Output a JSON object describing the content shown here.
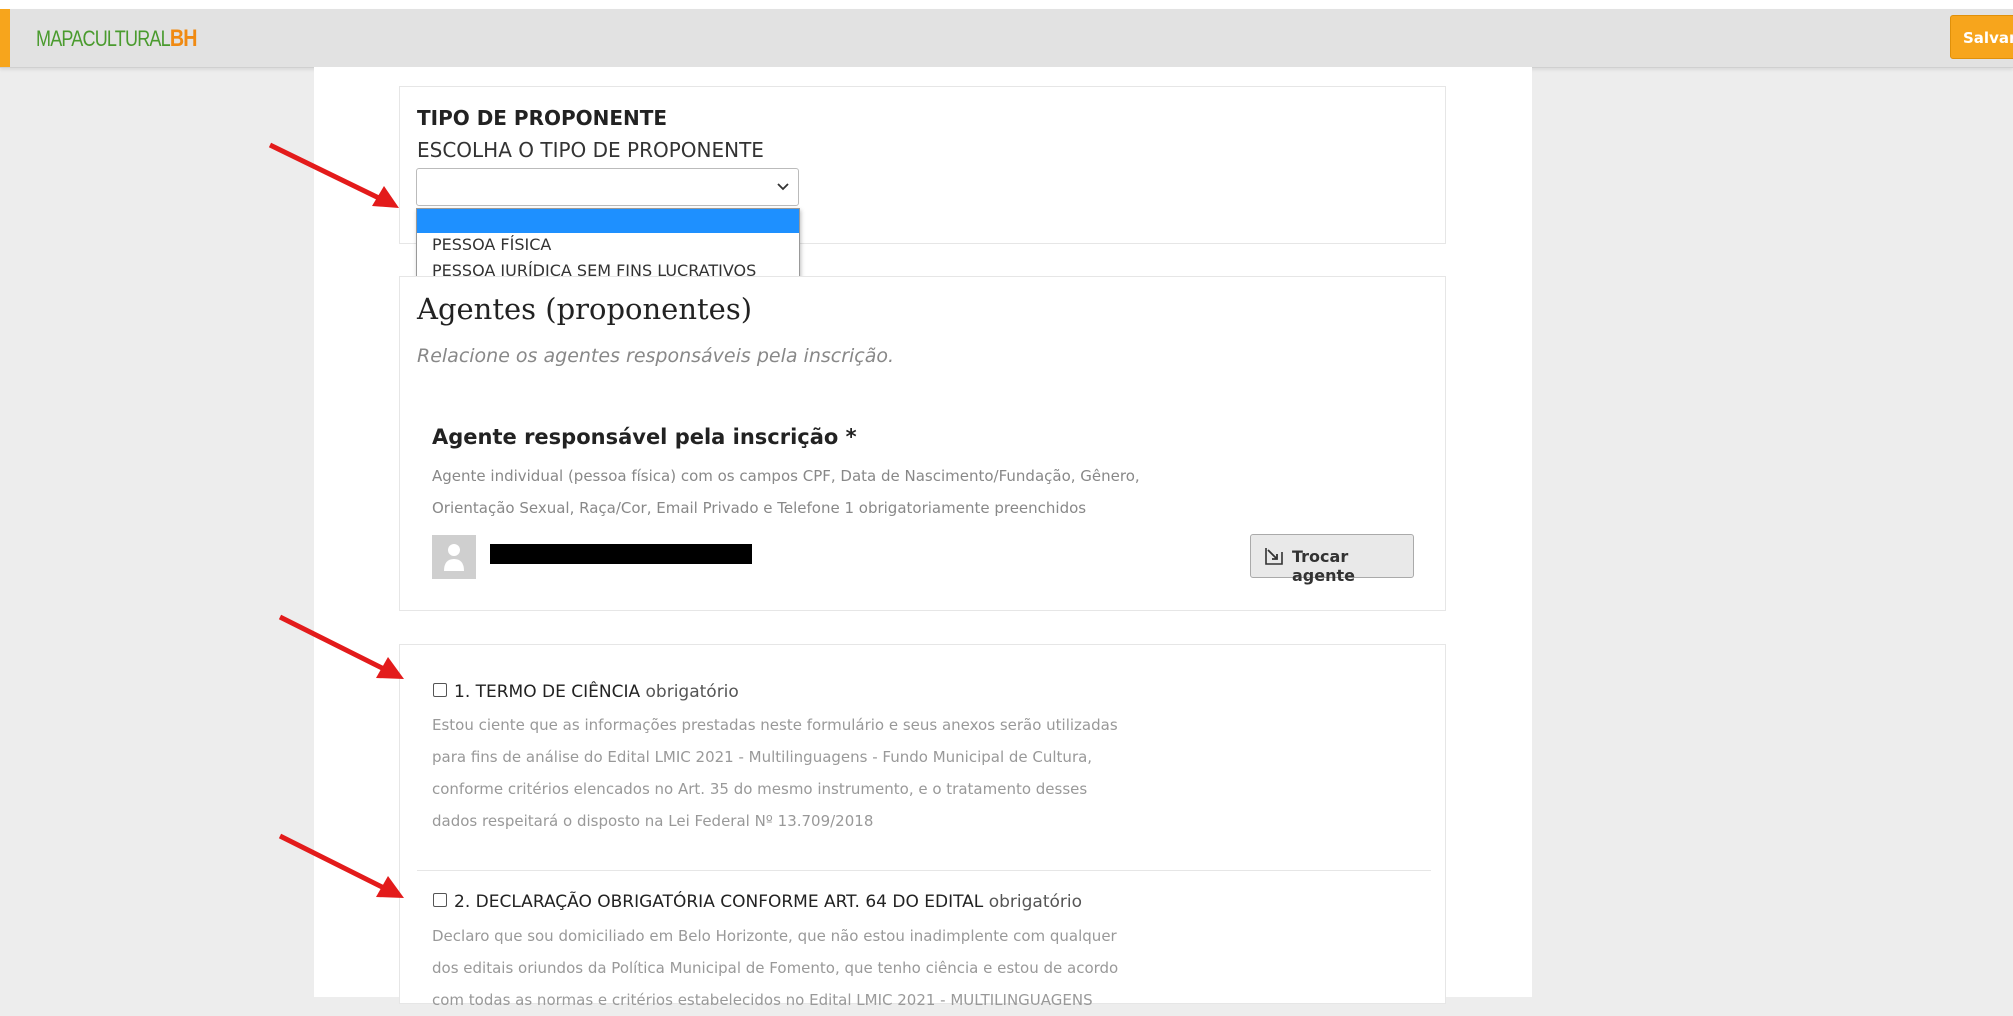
{
  "header": {
    "logo_part1": "MAPACULTURAL",
    "logo_part2": "BH",
    "save_label": "Salvar"
  },
  "proponente": {
    "title": "TIPO DE PROPONENTE",
    "subtitle": "ESCOLHA O TIPO DE PROPONENTE",
    "selected_value": "",
    "options": [
      "",
      "PESSOA FÍSICA",
      "PESSOA JURÍDICA SEM FINS LUCRATIVOS"
    ]
  },
  "agentes": {
    "title": "Agentes (proponentes)",
    "subtitle": "Relacione os agentes responsáveis pela inscrição.",
    "responsavel_title": "Agente responsável pela inscrição *",
    "responsavel_desc": "Agente individual (pessoa física) com os campos CPF, Data de Nascimento/Fundação, Gênero, Orientação Sexual, Raça/Cor, Email Privado e Telefone 1 obrigatoriamente preenchidos",
    "swap_label": "Trocar agente"
  },
  "termos": [
    {
      "title": "1. TERMO DE CIÊNCIA",
      "required_label": "obrigatório",
      "text": "Estou ciente que as informações prestadas neste formulário e seus anexos serão utilizadas para fins de análise do Edital LMIC 2021 - Multilinguagens - Fundo Municipal de Cultura, conforme critérios elencados no Art. 35 do mesmo instrumento, e o tratamento desses dados respeitará o disposto na Lei Federal Nº 13.709/2018"
    },
    {
      "title": "2. DECLARAÇÃO OBRIGATÓRIA CONFORME ART. 64 DO EDITAL",
      "required_label": "obrigatório",
      "text": "Declaro que sou domiciliado em Belo Horizonte, que não estou inadimplente com qualquer dos editais oriundos da Política Municipal de Fomento, que tenho ciência e estou de acordo com todas as normas e critérios estabelecidos no Edital LMIC 2021 - MULTILINGUAGENS"
    }
  ],
  "colors": {
    "accent": "#f7a51c",
    "logo_green": "#4a9b2e",
    "dropdown_highlight": "#1e90ff",
    "annotation_arrow": "#e31b1b"
  },
  "icons": {
    "select": "chevron-down-icon",
    "avatar": "user-silhouette-icon",
    "swap": "swap-arrow-icon"
  }
}
